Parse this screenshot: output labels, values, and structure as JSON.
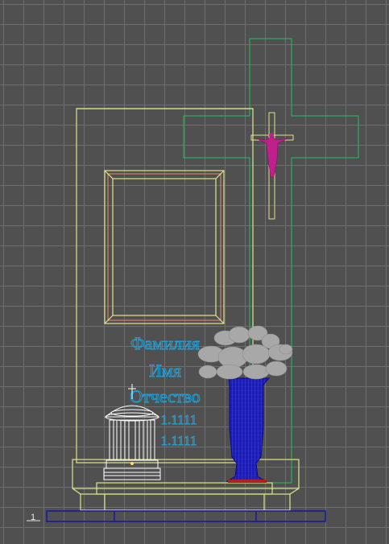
{
  "viewport": {
    "name": "3D wireframe viewport — grave monument",
    "colors": {
      "background": "#505050",
      "grid": "#6e6e6e",
      "stele_wireframe": "#e0e58a",
      "cross_outline": "#20c060",
      "crucifix": "#c0208c",
      "inscription": "#1e9fd6",
      "vase": "#1c1cb0",
      "base_plate": "#1a1a9a",
      "lantern": "#ffffff",
      "flowers": "#a8a8a8"
    }
  },
  "inscription": {
    "surname": "Фамилия",
    "name": "Имя",
    "patronymic": "Отчество",
    "date_birth": "1.1111",
    "date_death": "1.1111"
  },
  "axis_gizmo": {
    "label": "1"
  }
}
